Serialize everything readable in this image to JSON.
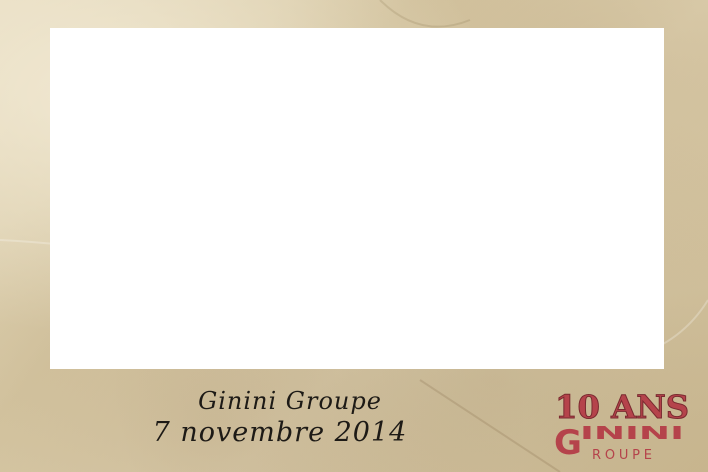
{
  "caption": {
    "line1": "Ginini Groupe",
    "line2": "7 novembre 2014"
  },
  "logo": {
    "anniversary": "10 ANS",
    "brand_rest": "ININI",
    "subtitle": "ROUPE",
    "color": "#b5434b"
  },
  "colors": {
    "paper": "#dccfb0",
    "photo_area": "#ffffff",
    "text": "#1d1a16"
  }
}
